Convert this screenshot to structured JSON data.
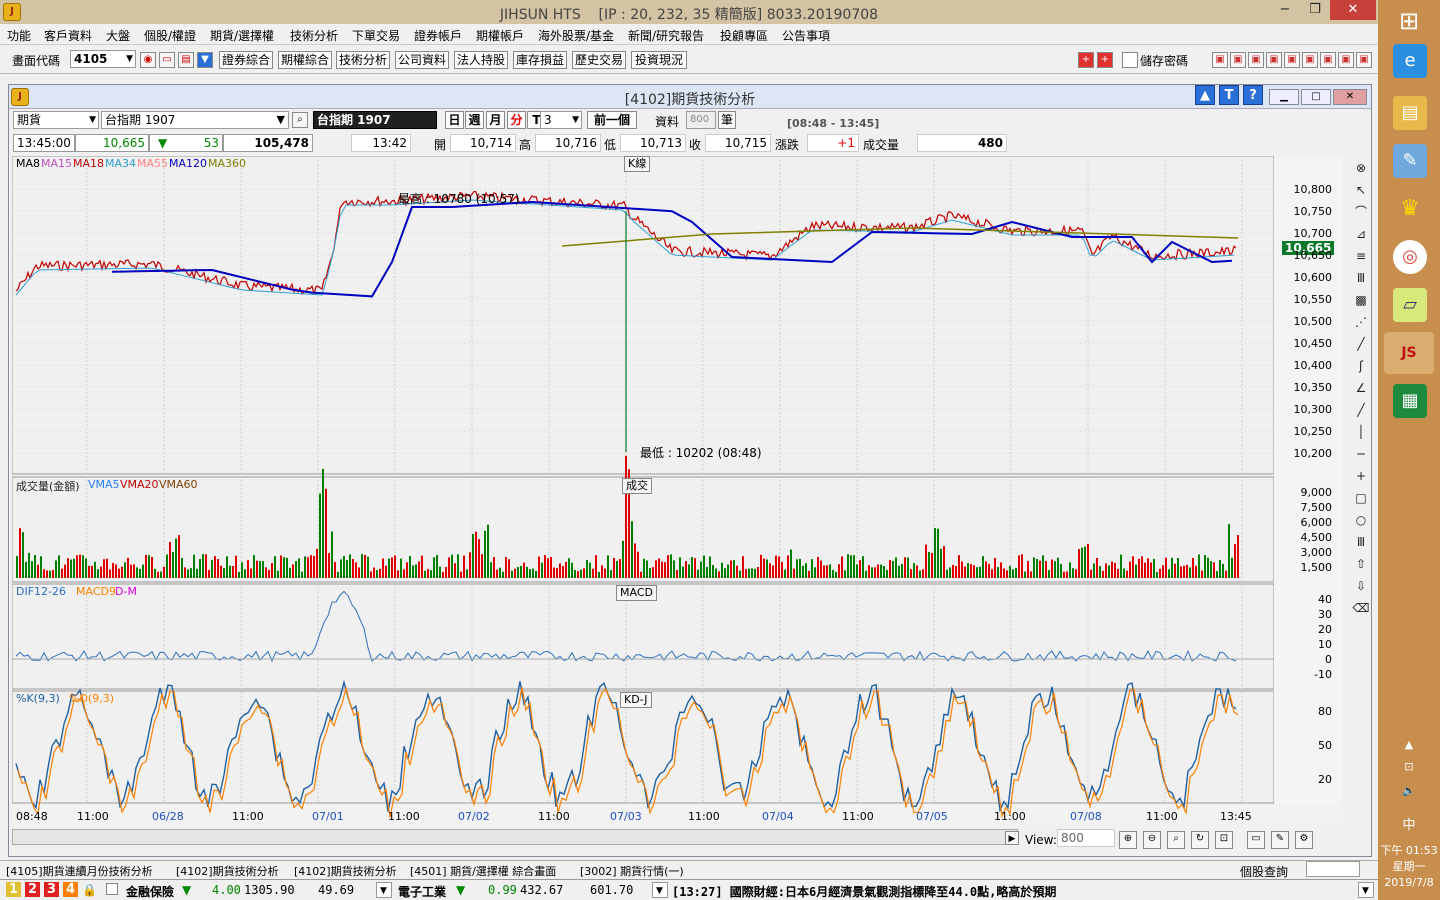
{
  "app": {
    "title": "JIHSUN HTS",
    "subtitle": "[IP : 20, 232, 35 精簡版] 8033.20190708",
    "min": "−",
    "restore": "❐",
    "close": "✕"
  },
  "menu": [
    "功能",
    "客戶資料",
    "大盤",
    "個股/權證",
    "期貨/選擇權",
    "技術分析",
    "下單交易",
    "證券帳戶",
    "期權帳戶",
    "海外股票/基金",
    "新聞/研究報告",
    "投顧專區",
    "公告事項"
  ],
  "toolbar": {
    "code_label": "畫面代碼",
    "code_value": "4105",
    "buttons": [
      "證券綜合",
      "期權綜合",
      "技術分析",
      "公司資料",
      "法人持股",
      "庫存損益",
      "歷史交易",
      "投資現況"
    ],
    "save_password": "儲存密碼"
  },
  "window": {
    "title": "[4102]期貨技術分析"
  },
  "controls": {
    "type": "期貨",
    "symbol": "台指期 1907",
    "symbol_display": "台指期 1907",
    "periods": [
      "日",
      "週",
      "月",
      "分",
      "T"
    ],
    "interval": "3",
    "prev": "前一個",
    "data_label": "資料",
    "data_count": "800",
    "unit": "筆",
    "session": "[08:48 - 13:45]"
  },
  "quote": {
    "time": "13:45:00",
    "price": "10,665",
    "change": "53",
    "volume_total": "105,478",
    "tick_time": "13:42",
    "open_label": "開",
    "open": "10,714",
    "high_label": "高",
    "high": "10,716",
    "low_label": "低",
    "low": "10,713",
    "close_label": "收",
    "close": "10,715",
    "chg_label": "漲跌",
    "chg": "+1",
    "vol_label": "成交量",
    "vol": "480"
  },
  "panels": {
    "kline": {
      "tag": "K線",
      "ma": [
        {
          "name": "MA8",
          "color": "#000000"
        },
        {
          "name": "MA15",
          "color": "#c050c0"
        },
        {
          "name": "MA18",
          "color": "#c00000"
        },
        {
          "name": "MA34",
          "color": "#30a0d0"
        },
        {
          "name": "MA55",
          "color": "#ff8080"
        },
        {
          "name": "MA120",
          "color": "#0000c0"
        },
        {
          "name": "MA360",
          "color": "#808000"
        }
      ],
      "high_note": "最高 : 10780 (10:57)",
      "low_note": "最低 : 10202 (08:48)",
      "last_price": "10,665",
      "yticks": [
        "10,800",
        "10,750",
        "10,700",
        "10,650",
        "10,600",
        "10,550",
        "10,500",
        "10,450",
        "10,400",
        "10,350",
        "10,300",
        "10,250",
        "10,200"
      ]
    },
    "volume": {
      "tag": "成交",
      "label": "成交量(金額)",
      "lines": [
        {
          "name": "VMA5",
          "color": "#2080ff"
        },
        {
          "name": "VMA20",
          "color": "#c00000"
        },
        {
          "name": "VMA60",
          "color": "#804000"
        }
      ],
      "yticks": [
        "9,000",
        "7,500",
        "6,000",
        "4,500",
        "3,000",
        "1,500"
      ]
    },
    "macd": {
      "tag": "MACD",
      "lines": [
        {
          "name": "DIF12-26",
          "color": "#3070c0"
        },
        {
          "name": "MACD9",
          "color": "#ff8000"
        },
        {
          "name": "D-M",
          "color": "#e000e0"
        }
      ],
      "yticks": [
        "40",
        "30",
        "20",
        "10",
        "0",
        "-10"
      ]
    },
    "kd": {
      "tag": "KD-J",
      "lines": [
        {
          "name": "%K(9,3)",
          "color": "#2060a0"
        },
        {
          "name": "%D(9,3)",
          "color": "#ff8000"
        }
      ],
      "yticks": [
        "80",
        "50",
        "20"
      ]
    }
  },
  "xaxis": [
    "08:48",
    "11:00",
    "06/28",
    "11:00",
    "07/01",
    "11:00",
    "07/02",
    "11:00",
    "07/03",
    "11:00",
    "07/04",
    "11:00",
    "07/05",
    "11:00",
    "07/08",
    "11:00",
    "13:45"
  ],
  "view": {
    "label": "View:",
    "value": "800"
  },
  "tabs": [
    "[4105]期貨連續月份技術分析",
    "[4102]期貨技術分析",
    "[4102]期貨技術分析",
    "[4501] 期貨/選擇權 綜合畫面",
    "[3002] 期貨行情(一)"
  ],
  "stock_query": "個股查詢",
  "status": {
    "nums": [
      "1",
      "2",
      "3",
      "4"
    ],
    "item1": "金融保險",
    "item1_chg": "4.00",
    "item1_val": "1305.90",
    "item1_amt": "49.69",
    "item2": "電子工業",
    "item2_chg": "0.99",
    "item2_val": "432.67",
    "item2_amt": "601.70",
    "news": "[13:27] 國際財經:日本6月經濟景氣觀測指標降至44.0點,略高於預期"
  },
  "tray": {
    "ime": "中",
    "time": "下午 01:53",
    "weekday": "星期一",
    "date": "2019/7/8"
  },
  "colors": {
    "up": "#e00000",
    "down": "#008000",
    "accent": "#2a6fd6"
  }
}
